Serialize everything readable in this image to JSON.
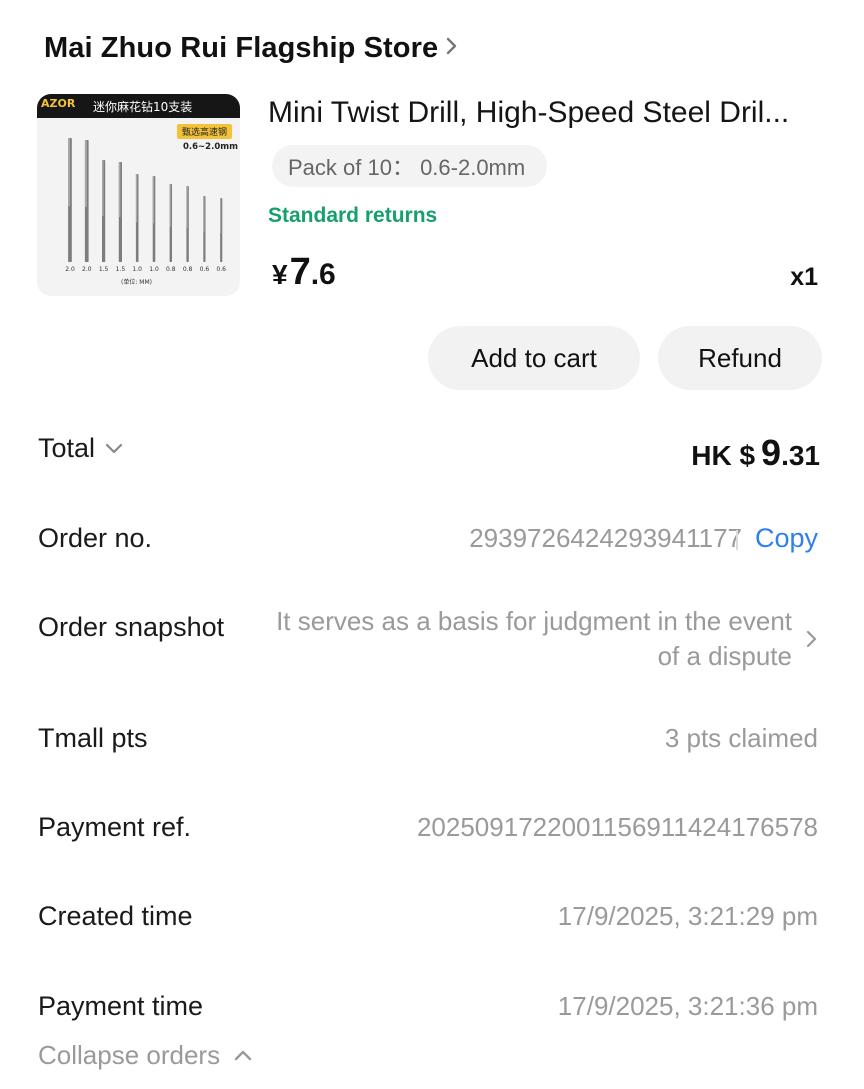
{
  "store": {
    "name": "Mai Zhuo Rui Flagship Store",
    "chevron_icon": "chevron-right-icon"
  },
  "product": {
    "image": {
      "brand": "AZOR",
      "headline_cn": "迷你麻花钻10支装",
      "tag_cn": "甄选高速钢",
      "range": "0.6~2.0mm",
      "sizes": [
        "2.0",
        "2.0",
        "1.5",
        "1.5",
        "1.0",
        "1.0",
        "0.8",
        "0.8",
        "0.6",
        "0.6"
      ],
      "unit_cn": "(单位: MM)"
    },
    "title": "Mini Twist Drill, High-Speed Steel Dril...",
    "sku": "Pack of 10：  0.6-2.0mm",
    "returns": "Standard returns",
    "price": {
      "currency": "¥",
      "integer": "7",
      "decimal": ".6"
    },
    "quantity": "x1"
  },
  "buttons": {
    "add_to_cart": "Add to cart",
    "refund": "Refund"
  },
  "total": {
    "label": "Total",
    "currency": "HK $",
    "integer": "9",
    "decimal": ".31"
  },
  "details": {
    "order_no": {
      "label": "Order no.",
      "value": "2939726424293941177",
      "copy": "Copy"
    },
    "snapshot": {
      "label": "Order snapshot",
      "value": "It serves as a basis for judgment in the event of a dispute"
    },
    "tmall_pts": {
      "label": "Tmall pts",
      "value": "3 pts claimed"
    },
    "payment_ref": {
      "label": "Payment ref.",
      "value": "2025091722001156911424176578"
    },
    "created_time": {
      "label": "Created time",
      "value": "17/9/2025, 3:21:29 pm"
    },
    "payment_time": {
      "label": "Payment time",
      "value": "17/9/2025, 3:21:36 pm"
    }
  },
  "collapse": {
    "label": "Collapse orders"
  },
  "colors": {
    "accent_green": "#16a06b",
    "link_blue": "#2f7ff0",
    "muted": "#9a9a9a"
  }
}
